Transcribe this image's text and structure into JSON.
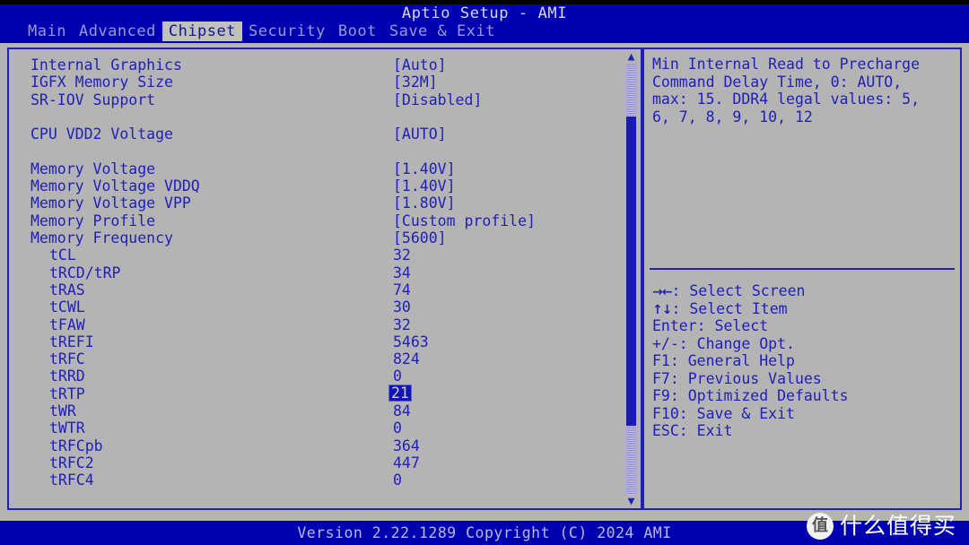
{
  "title": "Aptio Setup - AMI",
  "menu": {
    "items": [
      {
        "label": "Main",
        "active": false
      },
      {
        "label": "Advanced",
        "active": false
      },
      {
        "label": "Chipset",
        "active": true
      },
      {
        "label": "Security",
        "active": false
      },
      {
        "label": "Boot",
        "active": false
      },
      {
        "label": "Save & Exit",
        "active": false
      }
    ]
  },
  "settings": {
    "rows": [
      {
        "label": "Internal Graphics",
        "value": "[Auto]",
        "indent": false,
        "selected": false
      },
      {
        "label": "IGFX Memory Size",
        "value": "[32M]",
        "indent": false,
        "selected": false
      },
      {
        "label": "SR-IOV Support",
        "value": "[Disabled]",
        "indent": false,
        "selected": false
      },
      {
        "label": "",
        "value": "",
        "indent": false,
        "selected": false
      },
      {
        "label": "CPU VDD2 Voltage",
        "value": "[AUTO]",
        "indent": false,
        "selected": false
      },
      {
        "label": "",
        "value": "",
        "indent": false,
        "selected": false
      },
      {
        "label": "Memory Voltage",
        "value": "[1.40V]",
        "indent": false,
        "selected": false
      },
      {
        "label": "Memory Voltage VDDQ",
        "value": "[1.40V]",
        "indent": false,
        "selected": false
      },
      {
        "label": "Memory Voltage VPP",
        "value": "[1.80V]",
        "indent": false,
        "selected": false
      },
      {
        "label": "Memory Profile",
        "value": "[Custom profile]",
        "indent": false,
        "selected": false
      },
      {
        "label": "Memory Frequency",
        "value": "[5600]",
        "indent": false,
        "selected": false
      },
      {
        "label": "tCL",
        "value": "32",
        "indent": true,
        "selected": false
      },
      {
        "label": "tRCD/tRP",
        "value": "34",
        "indent": true,
        "selected": false
      },
      {
        "label": "tRAS",
        "value": "74",
        "indent": true,
        "selected": false
      },
      {
        "label": "tCWL",
        "value": "30",
        "indent": true,
        "selected": false
      },
      {
        "label": "tFAW",
        "value": "32",
        "indent": true,
        "selected": false
      },
      {
        "label": "tREFI",
        "value": "5463",
        "indent": true,
        "selected": false
      },
      {
        "label": "tRFC",
        "value": "824",
        "indent": true,
        "selected": false
      },
      {
        "label": "tRRD",
        "value": "0",
        "indent": true,
        "selected": false
      },
      {
        "label": "tRTP",
        "value": "21",
        "indent": true,
        "selected": true
      },
      {
        "label": "tWR",
        "value": "84",
        "indent": true,
        "selected": false
      },
      {
        "label": "tWTR",
        "value": "0",
        "indent": true,
        "selected": false
      },
      {
        "label": "tRFCpb",
        "value": "364",
        "indent": true,
        "selected": false
      },
      {
        "label": "tRFC2",
        "value": "447",
        "indent": true,
        "selected": false
      },
      {
        "label": "tRFC4",
        "value": "0",
        "indent": true,
        "selected": false
      }
    ]
  },
  "scrollbar": {
    "up_arrow": "▲",
    "down_arrow": "▼"
  },
  "help": {
    "text": "Min Internal Read to Precharge\nCommand Delay Time, 0: AUTO,\nmax: 15. DDR4 legal values: 5,\n6, 7, 8, 9, 10, 12",
    "keys": [
      {
        "glyph": "→←",
        "text": ": Select Screen"
      },
      {
        "glyph": "↑↓",
        "text": ": Select Item"
      },
      {
        "glyph": "",
        "text": "Enter: Select"
      },
      {
        "glyph": "",
        "text": "+/-: Change Opt."
      },
      {
        "glyph": "",
        "text": "F1: General Help"
      },
      {
        "glyph": "",
        "text": "F7: Previous Values"
      },
      {
        "glyph": "",
        "text": "F9: Optimized Defaults"
      },
      {
        "glyph": "",
        "text": "F10: Save & Exit"
      },
      {
        "glyph": "",
        "text": "ESC: Exit"
      }
    ]
  },
  "footer": {
    "text": "Version 2.22.1289 Copyright (C) 2024 AMI"
  },
  "watermark": {
    "badge": "值",
    "text": "什么值得买"
  },
  "colors": {
    "bios_blue": "#0000b0",
    "panel_gray": "#b4b4b4",
    "text_blue": "#2020b8",
    "highlight_bg": "#1414b4",
    "highlight_fg": "#d0d0d0",
    "menu_inactive": "#9a9ad0",
    "menu_active_bg": "#c0c0c0"
  }
}
